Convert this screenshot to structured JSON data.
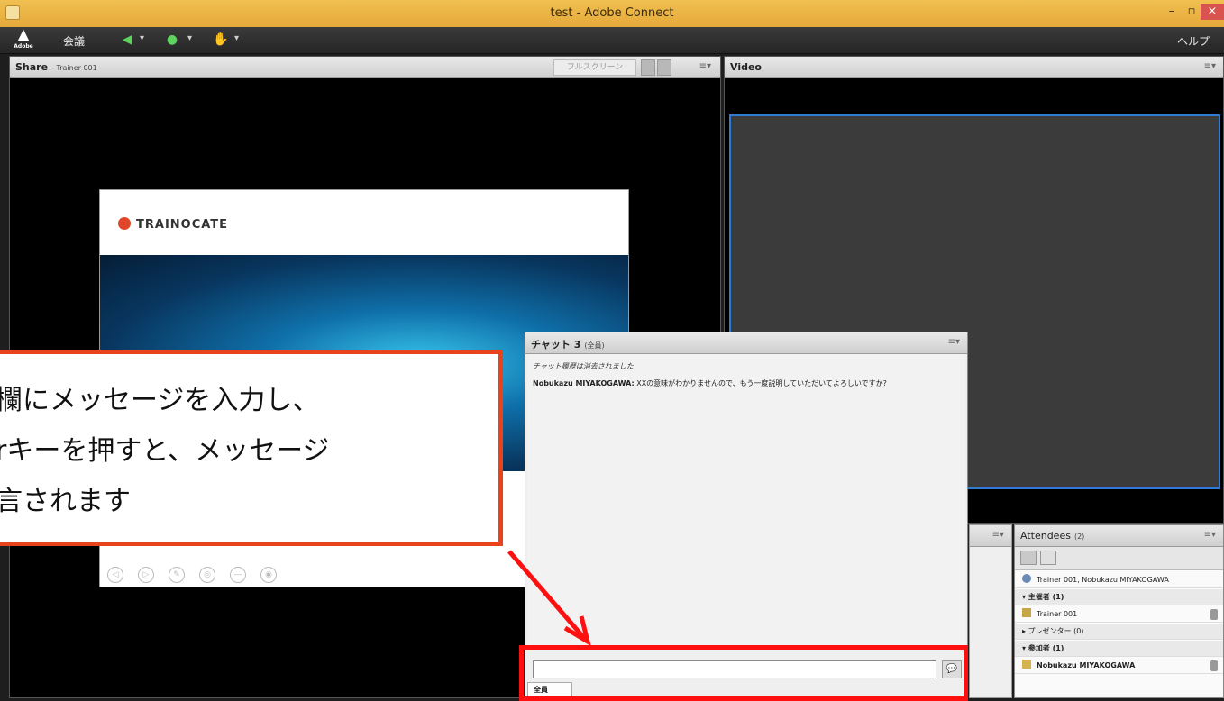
{
  "window": {
    "title": "test - Adobe Connect",
    "minimize": "–",
    "maximize": "▫",
    "close": "×"
  },
  "menubar": {
    "adobe_logo": "Adobe",
    "meeting_menu": "会議",
    "help_menu": "ヘルプ",
    "caret": "▾"
  },
  "share_pod": {
    "title": "Share",
    "presenter": "- Trainer 001",
    "fullscreen_label": "フルスクリーン",
    "menu": "≡▾"
  },
  "slide": {
    "brand": "TRAINOCATE",
    "controls": [
      "◁",
      "▷",
      "✎",
      "◎",
      "—",
      "◉"
    ]
  },
  "video_pod": {
    "title": "Video",
    "menu": "≡▾"
  },
  "chat_pod": {
    "title": "チャット 3",
    "scope": "(全員)",
    "menu": "≡▾",
    "system_message": "チャット履歴は消去されました",
    "message_author": "Nobukazu MIYAKOGAWA:",
    "message_text": "XXの意味がわかりませんので、もう一度説明していただいてよろしいですか?",
    "input_value": "",
    "send_icon": "💬",
    "tab_label": "全員"
  },
  "attendees_pod": {
    "title": "Attendees",
    "count": "(2)",
    "menu": "≡▾",
    "summary": "Trainer 001, Nobukazu MIYAKOGAWA",
    "groups": [
      {
        "label": "▾ 主催者 (1)",
        "member": "Trainer 001"
      },
      {
        "label": "▸ プレゼンター (0)",
        "member": ""
      },
      {
        "label": "▾ 参加者 (1)",
        "member": "Nobukazu MIYAKOGAWA"
      }
    ]
  },
  "callout": {
    "lines": [
      "欄にメッセージを入力し、",
      "rキーを押すと、メッセージ",
      "言されます"
    ],
    "border_color": "#e8431a"
  },
  "colors": {
    "highlight_red": "#ff1010",
    "video_border": "#2e7cd6",
    "accent_green": "#5fd35f"
  }
}
